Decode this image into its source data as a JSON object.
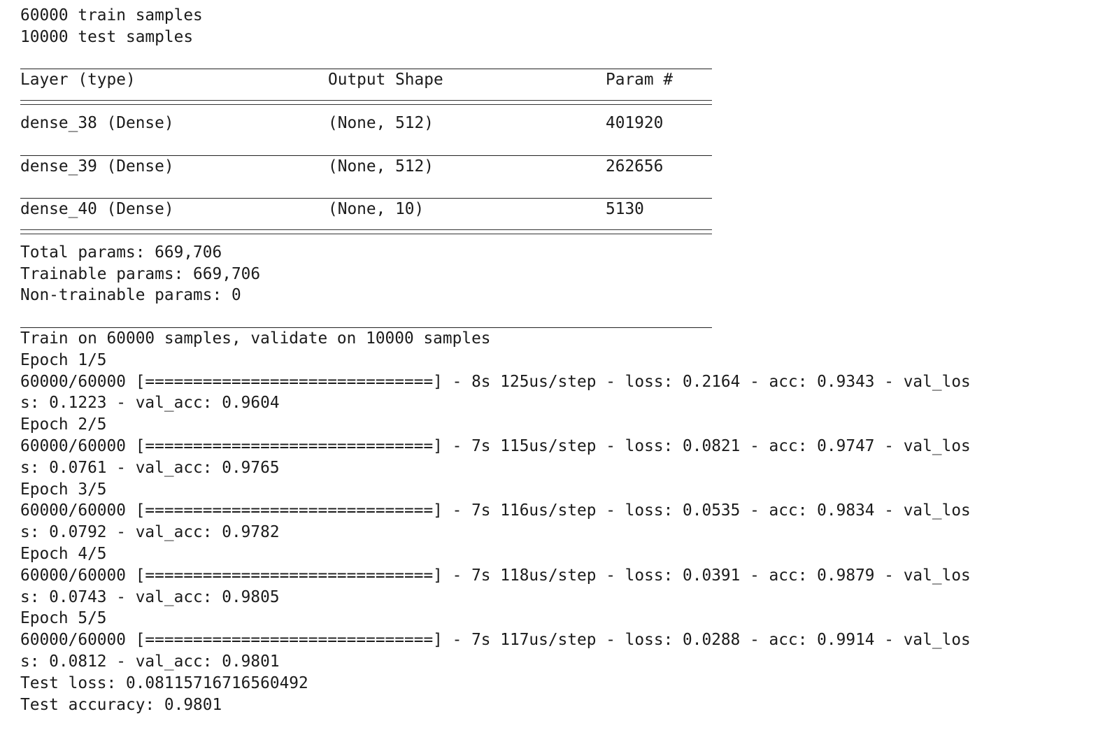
{
  "header_lines": [
    "60000 train samples",
    "10000 test samples"
  ],
  "summary": {
    "columns": [
      "Layer (type)",
      "Output Shape",
      "Param #"
    ],
    "rows": [
      [
        "dense_38 (Dense)",
        "(None, 512)",
        "401920"
      ],
      [
        "dense_39 (Dense)",
        "(None, 512)",
        "262656"
      ],
      [
        "dense_40 (Dense)",
        "(None, 10)",
        "5130"
      ]
    ],
    "total_params": "Total params: 669,706",
    "trainable_params": "Trainable params: 669,706",
    "non_trainable_params": "Non-trainable params: 0"
  },
  "training": {
    "intro": "Train on 60000 samples, validate on 10000 samples",
    "epochs": [
      {
        "label": "Epoch 1/5",
        "line1": "60000/60000 [==============================] - 8s 125us/step - loss: 0.2164 - acc: 0.9343 - val_los",
        "line2": "s: 0.1223 - val_acc: 0.9604"
      },
      {
        "label": "Epoch 2/5",
        "line1": "60000/60000 [==============================] - 7s 115us/step - loss: 0.0821 - acc: 0.9747 - val_los",
        "line2": "s: 0.0761 - val_acc: 0.9765"
      },
      {
        "label": "Epoch 3/5",
        "line1": "60000/60000 [==============================] - 7s 116us/step - loss: 0.0535 - acc: 0.9834 - val_los",
        "line2": "s: 0.0792 - val_acc: 0.9782"
      },
      {
        "label": "Epoch 4/5",
        "line1": "60000/60000 [==============================] - 7s 118us/step - loss: 0.0391 - acc: 0.9879 - val_los",
        "line2": "s: 0.0743 - val_acc: 0.9805"
      },
      {
        "label": "Epoch 5/5",
        "line1": "60000/60000 [==============================] - 7s 117us/step - loss: 0.0288 - acc: 0.9914 - val_los",
        "line2": "s: 0.0812 - val_acc: 0.9801"
      }
    ]
  },
  "results": {
    "test_loss": "Test loss: 0.08115716716560492",
    "test_accuracy": "Test accuracy: 0.9801"
  }
}
